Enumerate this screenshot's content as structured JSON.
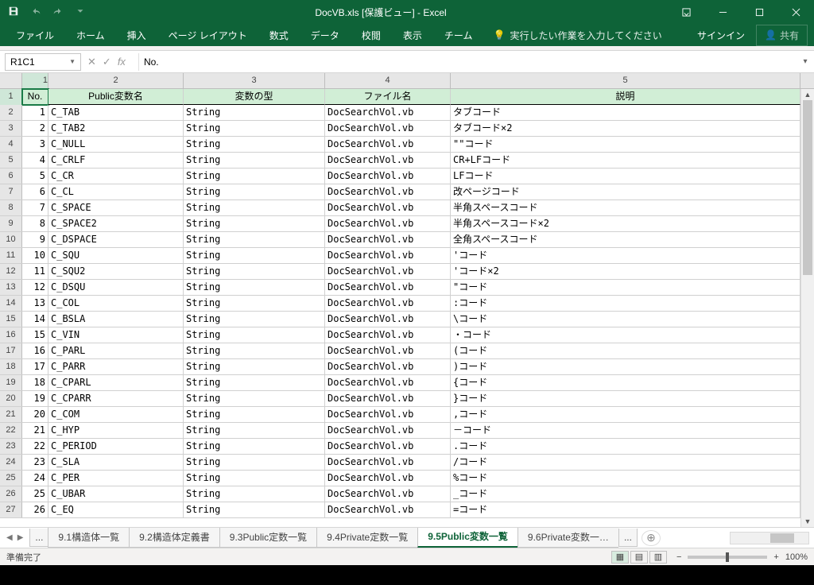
{
  "titlebar": {
    "title": "DocVB.xls  [保護ビュー] - Excel"
  },
  "ribbon": {
    "tabs": [
      "ファイル",
      "ホーム",
      "挿入",
      "ページ レイアウト",
      "数式",
      "データ",
      "校閲",
      "表示",
      "チーム"
    ],
    "tell_me": "実行したい作業を入力してください",
    "signin": "サインイン",
    "share": "共有"
  },
  "formula_bar": {
    "name_box": "R1C1",
    "fx": "fx",
    "value": "No."
  },
  "grid": {
    "col_headers": [
      "1",
      "2",
      "3",
      "4",
      "5"
    ],
    "header_row": [
      "No.",
      "Public変数名",
      "変数の型",
      "ファイル名",
      "説明"
    ],
    "rows": [
      {
        "no": "1",
        "name": "C_TAB",
        "type": "String",
        "file": "DocSearchVol.vb",
        "desc": "タブコード"
      },
      {
        "no": "2",
        "name": "C_TAB2",
        "type": "String",
        "file": "DocSearchVol.vb",
        "desc": "タブコード×2"
      },
      {
        "no": "3",
        "name": "C_NULL",
        "type": "String",
        "file": "DocSearchVol.vb",
        "desc": "\"\"コード"
      },
      {
        "no": "4",
        "name": "C_CRLF",
        "type": "String",
        "file": "DocSearchVol.vb",
        "desc": "CR+LFコード"
      },
      {
        "no": "5",
        "name": "C_CR",
        "type": "String",
        "file": "DocSearchVol.vb",
        "desc": "LFコード"
      },
      {
        "no": "6",
        "name": "C_CL",
        "type": "String",
        "file": "DocSearchVol.vb",
        "desc": "改ページコード"
      },
      {
        "no": "7",
        "name": "C_SPACE",
        "type": "String",
        "file": "DocSearchVol.vb",
        "desc": "半角スペースコード"
      },
      {
        "no": "8",
        "name": "C_SPACE2",
        "type": "String",
        "file": "DocSearchVol.vb",
        "desc": "半角スペースコード×2"
      },
      {
        "no": "9",
        "name": "C_DSPACE",
        "type": "String",
        "file": "DocSearchVol.vb",
        "desc": "全角スペースコード"
      },
      {
        "no": "10",
        "name": "C_SQU",
        "type": "String",
        "file": "DocSearchVol.vb",
        "desc": "'コード"
      },
      {
        "no": "11",
        "name": "C_SQU2",
        "type": "String",
        "file": "DocSearchVol.vb",
        "desc": "'コード×2"
      },
      {
        "no": "12",
        "name": "C_DSQU",
        "type": "String",
        "file": "DocSearchVol.vb",
        "desc": "\"コード"
      },
      {
        "no": "13",
        "name": "C_COL",
        "type": "String",
        "file": "DocSearchVol.vb",
        "desc": ":コード"
      },
      {
        "no": "14",
        "name": "C_BSLA",
        "type": "String",
        "file": "DocSearchVol.vb",
        "desc": "\\コード"
      },
      {
        "no": "15",
        "name": "C_VIN",
        "type": "String",
        "file": "DocSearchVol.vb",
        "desc": "・コード"
      },
      {
        "no": "16",
        "name": "C_PARL",
        "type": "String",
        "file": "DocSearchVol.vb",
        "desc": "(コード"
      },
      {
        "no": "17",
        "name": "C_PARR",
        "type": "String",
        "file": "DocSearchVol.vb",
        "desc": ")コード"
      },
      {
        "no": "18",
        "name": "C_CPARL",
        "type": "String",
        "file": "DocSearchVol.vb",
        "desc": "{コード"
      },
      {
        "no": "19",
        "name": "C_CPARR",
        "type": "String",
        "file": "DocSearchVol.vb",
        "desc": "}コード"
      },
      {
        "no": "20",
        "name": "C_COM",
        "type": "String",
        "file": "DocSearchVol.vb",
        "desc": ",コード"
      },
      {
        "no": "21",
        "name": "C_HYP",
        "type": "String",
        "file": "DocSearchVol.vb",
        "desc": "－コード"
      },
      {
        "no": "22",
        "name": "C_PERIOD",
        "type": "String",
        "file": "DocSearchVol.vb",
        "desc": ".コード"
      },
      {
        "no": "23",
        "name": "C_SLA",
        "type": "String",
        "file": "DocSearchVol.vb",
        "desc": "/コード"
      },
      {
        "no": "24",
        "name": "C_PER",
        "type": "String",
        "file": "DocSearchVol.vb",
        "desc": "%コード"
      },
      {
        "no": "25",
        "name": "C_UBAR",
        "type": "String",
        "file": "DocSearchVol.vb",
        "desc": "_コード"
      },
      {
        "no": "26",
        "name": "C_EQ",
        "type": "String",
        "file": "DocSearchVol.vb",
        "desc": "=コード"
      }
    ]
  },
  "sheets": {
    "ellipsis": "...",
    "tabs": [
      {
        "label": "9.1構造体一覧",
        "active": false
      },
      {
        "label": "9.2構造体定義書",
        "active": false
      },
      {
        "label": "9.3Public定数一覧",
        "active": false
      },
      {
        "label": "9.4Private定数一覧",
        "active": false
      },
      {
        "label": "9.5Public変数一覧",
        "active": true
      },
      {
        "label": "9.6Private変数一…",
        "active": false
      }
    ]
  },
  "status": {
    "ready": "準備完了",
    "zoom": "100%"
  }
}
